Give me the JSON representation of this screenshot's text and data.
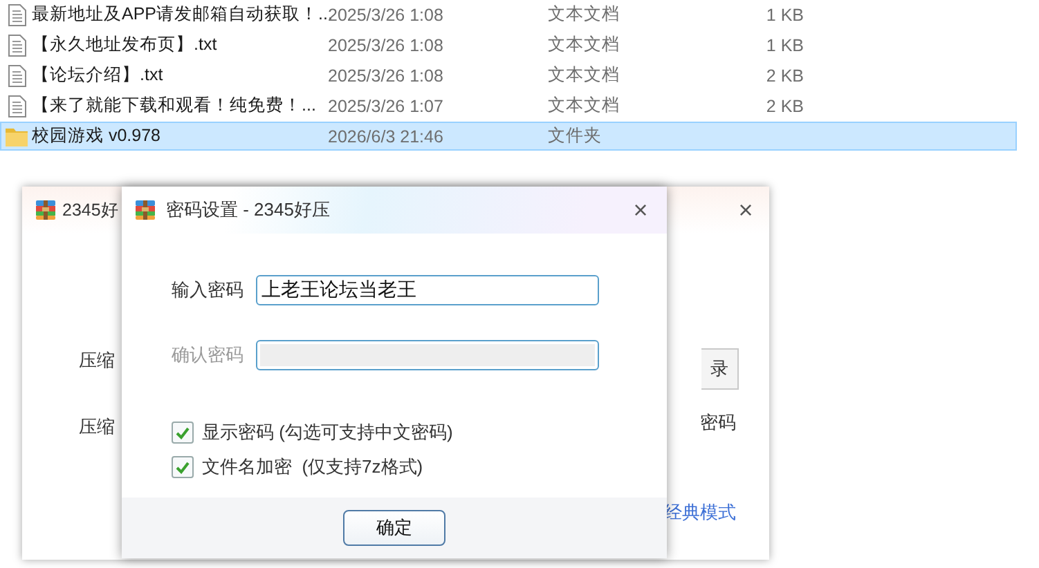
{
  "files": [
    {
      "kind": "text",
      "name": "最新地址及APP请发邮箱自动获取！...",
      "date": "2025/3/26 1:08",
      "type": "文本文档",
      "size": "1 KB",
      "selected": false
    },
    {
      "kind": "text",
      "name": "【永久地址发布页】.txt",
      "date": "2025/3/26 1:08",
      "type": "文本文档",
      "size": "1 KB",
      "selected": false
    },
    {
      "kind": "text",
      "name": "【论坛介绍】.txt",
      "date": "2025/3/26 1:08",
      "type": "文本文档",
      "size": "2 KB",
      "selected": false
    },
    {
      "kind": "text",
      "name": "【来了就能下载和观看！纯免费！...",
      "date": "2025/3/26 1:07",
      "type": "文本文档",
      "size": "2 KB",
      "selected": false
    },
    {
      "kind": "folder",
      "name": "校园游戏 v0.978",
      "date": "2026/6/3 21:46",
      "type": "文件夹",
      "selected": true
    }
  ],
  "main_window": {
    "title": "2345好",
    "close": "×",
    "left_texts": [
      "压缩",
      "压缩"
    ],
    "button": "录",
    "right_text": "密码",
    "link": "经典模式"
  },
  "dialog": {
    "title": "密码设置 - 2345好压",
    "close": "×",
    "fields": [
      {
        "label": "输入密码",
        "value": "上老王论坛当老王",
        "disabled": false
      },
      {
        "label": "确认密码",
        "disabled": true
      }
    ],
    "options": [
      {
        "label": "显示密码 (勾选可支持中文密码)",
        "checked": true
      },
      {
        "label": "文件名加密  (仅支持7z格式)",
        "checked": true
      }
    ],
    "button": "确定"
  }
}
